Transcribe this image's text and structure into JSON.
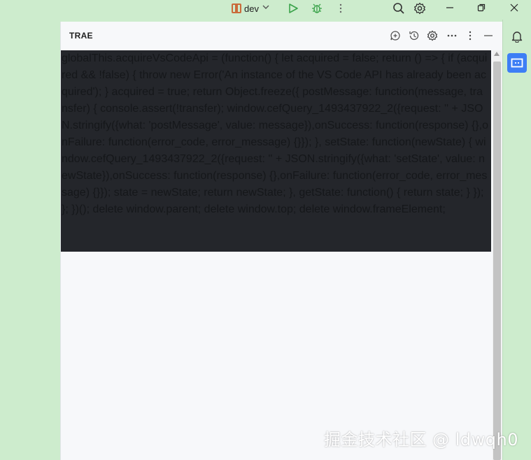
{
  "titlebar": {
    "run_config": "dev",
    "icons": [
      "run-config-icon",
      "chevron-down-icon",
      "run-icon",
      "debug-icon",
      "more-vertical-icon",
      "search-icon",
      "settings-icon",
      "minimize-icon",
      "restore-icon",
      "close-icon"
    ]
  },
  "panel": {
    "title": "TRAE",
    "header_icons": [
      "new-chat-icon",
      "history-icon",
      "settings-icon",
      "more-horizontal-icon",
      "more-vertical-icon",
      "minimize-icon"
    ]
  },
  "code_text": "globalThis.acquireVsCodeApi = (function() { let acquired = false; return () => { if (acquired && !false) { throw new Error('An instance of the VS Code API has already been acquired'); } acquired = true; return Object.freeze({ postMessage: function(message, transfer) { console.assert(!transfer); window.cefQuery_1493437922_2({request: '' + JSON.stringify({what: 'postMessage', value: message}),onSuccess: function(response) {},onFailure: function(error_code, error_message) {}}); }, setState: function(newState) { window.cefQuery_1493437922_2({request: '' + JSON.stringify({what: 'setState', value: newState}),onSuccess: function(response) {},onFailure: function(error_code, error_message) {}}); state = newState; return newState; }, getState: function() { return state; } }); }; })(); delete window.parent; delete window.top; delete window.frameElement;",
  "right_strip": {
    "icons": [
      "notifications-icon",
      "trae-chat-icon"
    ]
  },
  "watermark": "掘金技术社区 @ ldwqh0",
  "colors": {
    "background": "#cdeccd",
    "panel": "#f7f8fa",
    "code_bg": "#24262b",
    "accent": "#3d7ef5",
    "run_green": "#3aa34a"
  }
}
